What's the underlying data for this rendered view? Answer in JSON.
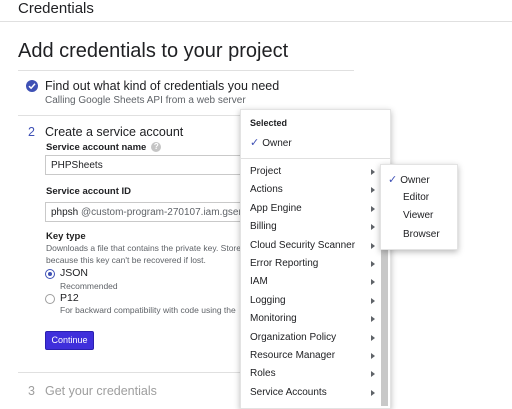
{
  "topbar": {
    "title": "Credentials"
  },
  "page_title": "Add credentials to your project",
  "step1": {
    "heading": "Find out what kind of credentials you need",
    "subtext": "Calling Google Sheets API from a web server"
  },
  "step2": {
    "number": "2",
    "heading": "Create a service account",
    "name_label": "Service account name",
    "name_value": "PHPSheets",
    "id_label": "Service account ID",
    "id_prefix": "phpsh",
    "id_suffix": "@custom-program-270107.iam.gservic",
    "key_type_label": "Key type",
    "key_desc_1": "Downloads a file that contains the private key. Store",
    "key_desc_2": "because this key can't be recovered if lost.",
    "json_label": "JSON",
    "json_sub": "Recommended",
    "p12_label": "P12",
    "p12_sub": "For backward compatibility with code using the",
    "continue_label": "Continue"
  },
  "step3": {
    "number": "3",
    "heading": "Get your credentials"
  },
  "role_menu": {
    "selected_label": "Selected",
    "selected_role": "Owner",
    "items": [
      "Project",
      "Actions",
      "App Engine",
      "Billing",
      "Cloud Security Scanner",
      "Error Reporting",
      "IAM",
      "Logging",
      "Monitoring",
      "Organization Policy",
      "Resource Manager",
      "Roles",
      "Service Accounts"
    ]
  },
  "submenu": {
    "items": [
      "Owner",
      "Editor",
      "Viewer",
      "Browser"
    ]
  },
  "colors": {
    "accent": "#3f51b5",
    "button": "#3f2fdb"
  }
}
